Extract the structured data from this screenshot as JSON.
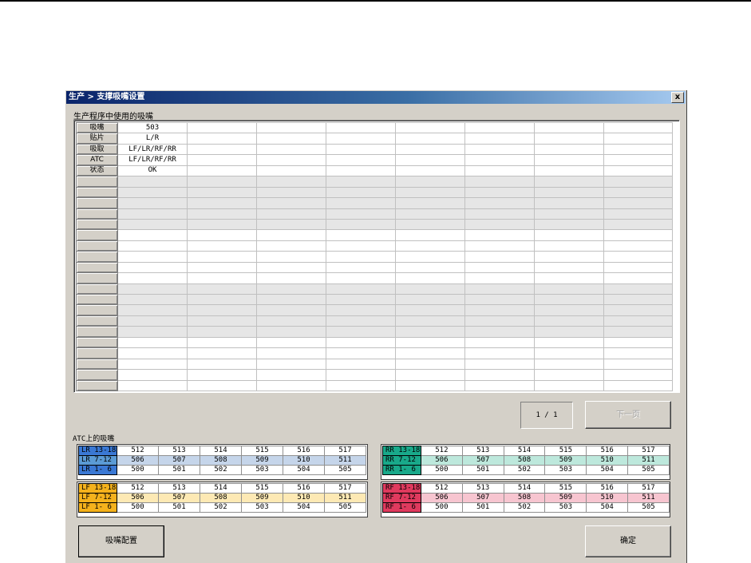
{
  "dialog": {
    "title": "生产 > 支撑吸嘴设置",
    "close_label": "x"
  },
  "used_nozzles": {
    "label": "生产程序中使用的吸嘴",
    "row_headers": [
      "吸嘴",
      "贴片",
      "吸取",
      "ATC",
      "状态"
    ],
    "values": [
      "503",
      "L/R",
      "LF/LR/RF/RR",
      "LF/LR/RF/RR",
      "OK"
    ]
  },
  "pagination": {
    "indicator": "1 / 1",
    "next_label": "下一页"
  },
  "atc": {
    "label": "ATC上的吸嘴",
    "groups": [
      {
        "colors": [
          "#3a78d4",
          "#5b9bd5",
          "#3a78d4"
        ],
        "mid_bg": "#c5d5ea",
        "rows": [
          {
            "label": "LR 13-18",
            "values": [
              "512",
              "513",
              "514",
              "515",
              "516",
              "517"
            ]
          },
          {
            "label": "LR  7-12",
            "values": [
              "506",
              "507",
              "508",
              "509",
              "510",
              "511"
            ]
          },
          {
            "label": "LR  1- 6",
            "values": [
              "500",
              "501",
              "502",
              "503",
              "504",
              "505"
            ]
          }
        ]
      },
      {
        "colors": [
          "#19a98a",
          "#19a98a",
          "#19a98a"
        ],
        "mid_bg": "#bde8dc",
        "rows": [
          {
            "label": "RR 13-18",
            "values": [
              "512",
              "513",
              "514",
              "515",
              "516",
              "517"
            ]
          },
          {
            "label": "RR  7-12",
            "values": [
              "506",
              "507",
              "508",
              "509",
              "510",
              "511"
            ]
          },
          {
            "label": "RR  1- 6",
            "values": [
              "500",
              "501",
              "502",
              "503",
              "504",
              "505"
            ]
          }
        ]
      },
      {
        "colors": [
          "#f5b21c",
          "#f5b21c",
          "#f5b21c"
        ],
        "mid_bg": "#fde9b4",
        "rows": [
          {
            "label": "LF 13-18",
            "values": [
              "512",
              "513",
              "514",
              "515",
              "516",
              "517"
            ]
          },
          {
            "label": "LF  7-12",
            "values": [
              "506",
              "507",
              "508",
              "509",
              "510",
              "511"
            ]
          },
          {
            "label": "LF  1- 6",
            "values": [
              "500",
              "501",
              "502",
              "503",
              "504",
              "505"
            ]
          }
        ]
      },
      {
        "colors": [
          "#e03a5e",
          "#e03a5e",
          "#e03a5e"
        ],
        "mid_bg": "#f7c5d0",
        "rows": [
          {
            "label": "RF 13-18",
            "values": [
              "512",
              "513",
              "514",
              "515",
              "516",
              "517"
            ]
          },
          {
            "label": "RF  7-12",
            "values": [
              "506",
              "507",
              "508",
              "509",
              "510",
              "511"
            ]
          },
          {
            "label": "RF  1- 6",
            "values": [
              "500",
              "501",
              "502",
              "503",
              "504",
              "505"
            ]
          }
        ]
      }
    ]
  },
  "buttons": {
    "nozzle_config": "吸嘴配置",
    "confirm": "确定"
  }
}
